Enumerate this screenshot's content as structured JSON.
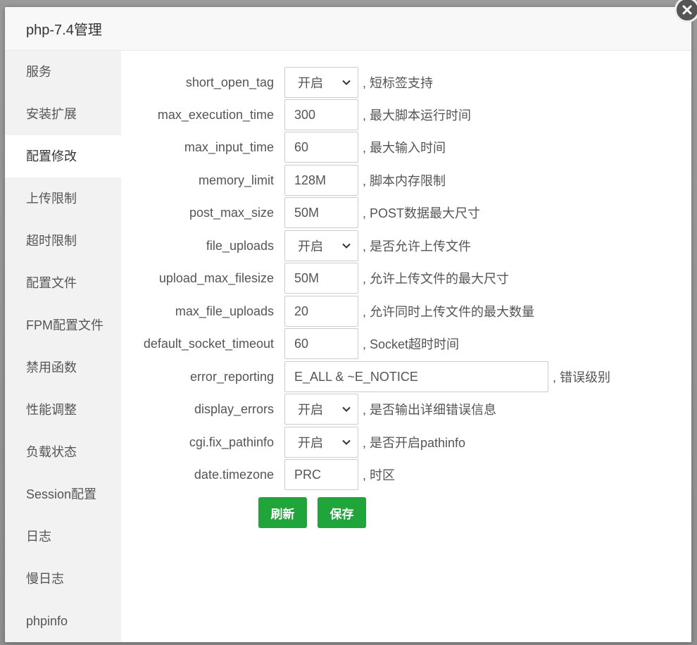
{
  "dialog": {
    "title": "php-7.4管理"
  },
  "sidebar": {
    "items": [
      {
        "label": "服务"
      },
      {
        "label": "安装扩展"
      },
      {
        "label": "配置修改"
      },
      {
        "label": "上传限制"
      },
      {
        "label": "超时限制"
      },
      {
        "label": "配置文件"
      },
      {
        "label": "FPM配置文件"
      },
      {
        "label": "禁用函数"
      },
      {
        "label": "性能调整"
      },
      {
        "label": "负载状态"
      },
      {
        "label": "Session配置"
      },
      {
        "label": "日志"
      },
      {
        "label": "慢日志"
      },
      {
        "label": "phpinfo"
      }
    ],
    "active_index": 2
  },
  "form": {
    "rows": [
      {
        "key": "short_open_tag",
        "value": "开启",
        "desc": ", 短标签支持"
      },
      {
        "key": "max_execution_time",
        "value": "300",
        "desc": ", 最大脚本运行时间"
      },
      {
        "key": "max_input_time",
        "value": "60",
        "desc": ", 最大输入时间"
      },
      {
        "key": "memory_limit",
        "value": "128M",
        "desc": ", 脚本内存限制"
      },
      {
        "key": "post_max_size",
        "value": "50M",
        "desc": ", POST数据最大尺寸"
      },
      {
        "key": "file_uploads",
        "value": "开启",
        "desc": ", 是否允许上传文件"
      },
      {
        "key": "upload_max_filesize",
        "value": "50M",
        "desc": ", 允许上传文件的最大尺寸"
      },
      {
        "key": "max_file_uploads",
        "value": "20",
        "desc": ", 允许同时上传文件的最大数量"
      },
      {
        "key": "default_socket_timeout",
        "value": "60",
        "desc": ", Socket超时时间"
      },
      {
        "key": "error_reporting",
        "value": "E_ALL & ~E_NOTICE",
        "desc": ", 错误级别"
      },
      {
        "key": "display_errors",
        "value": "开启",
        "desc": ", 是否输出详细错误信息"
      },
      {
        "key": "cgi.fix_pathinfo",
        "value": "开启",
        "desc": ", 是否开启pathinfo"
      },
      {
        "key": "date.timezone",
        "value": "PRC",
        "desc": ", 时区"
      }
    ]
  },
  "buttons": {
    "refresh": "刷新",
    "save": "保存"
  },
  "icons": {
    "close": "close-icon",
    "select": "chevron-down-icon"
  },
  "colors": {
    "accent": "#20a53a"
  }
}
